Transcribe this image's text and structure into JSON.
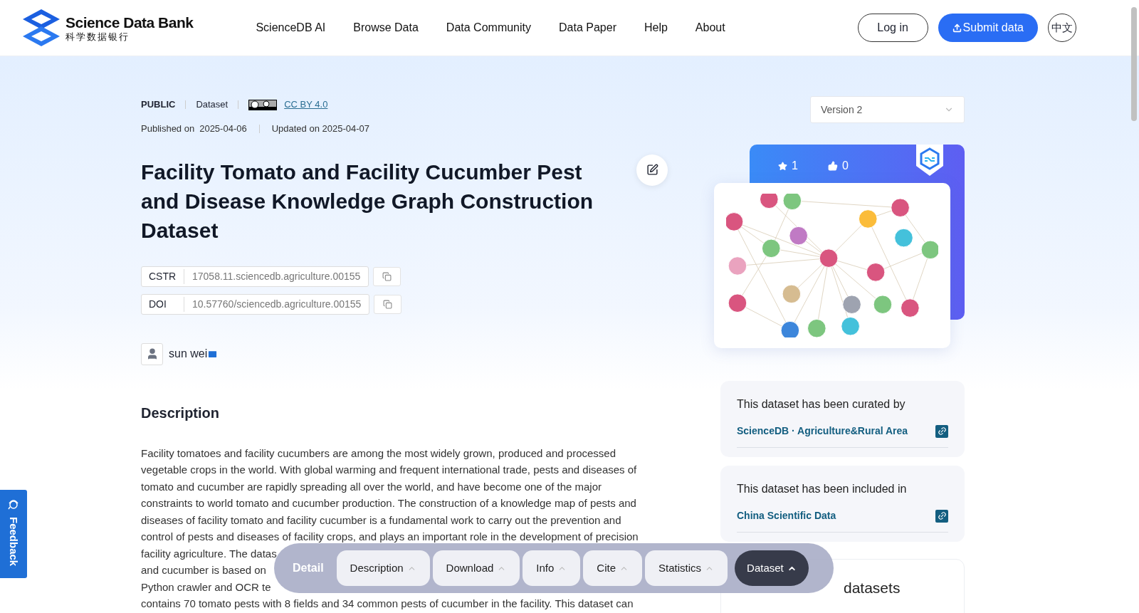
{
  "header": {
    "logo": {
      "title": "Science Data Bank",
      "subtitle": "科学数据银行"
    },
    "nav": [
      "ScienceDB AI",
      "Browse Data",
      "Data Community",
      "Data Paper",
      "Help",
      "About"
    ],
    "login": "Log in",
    "submit": "Submit data",
    "language": "中文"
  },
  "meta": {
    "access": "PUBLIC",
    "type": "Dataset",
    "license": "CC BY 4.0",
    "published_label": "Published on",
    "published": "2025-04-06",
    "updated": "Updated on 2025-04-07"
  },
  "title": "Facility Tomato and Facility Cucumber Pest and Disease Knowledge Graph Construction Dataset",
  "identifiers": [
    {
      "label": "CSTR",
      "value": "17058.11.sciencedb.agriculture.00155"
    },
    {
      "label": "DOI",
      "value": "10.57760/sciencedb.agriculture.00155"
    }
  ],
  "author": {
    "name": "sun wei"
  },
  "description": {
    "heading": "Description",
    "lines": [
      "Facility tomatoes and facility cucumbers are among the most widely grown, produced and processed",
      "vegetable crops in the world. With global warming and frequent international trade, pests and diseases of",
      "tomato and cucumber are rapidly spreading all over the world, and have become one of the major",
      "constraints to world tomato and cucumber production. The construction of a knowledge map of pests and",
      "diseases of facility tomato and facility cucumber is a fundamental work to carry out the prevention and",
      "control of pests and diseases of facility crops, and plays an important role in the development of precision",
      "facility agriculture. The datas",
      "and cucumber is based on",
      "Python crawler and OCR te",
      "contains 70 tomato pests with 8 fields and 34 common pests of cucumber in the facility. This dataset can"
    ]
  },
  "sidebar": {
    "version": "Version 2",
    "favorites": "1",
    "likes": "0",
    "cards": [
      {
        "caption": "This dataset has been curated by",
        "link": "ScienceDB · Agriculture&Rural Area"
      },
      {
        "caption": "This dataset has been included in",
        "link": "China Scientific Data"
      }
    ],
    "related": {
      "title": "datasets"
    }
  },
  "section_bar": {
    "title": "Detail",
    "items": [
      {
        "label": "Description",
        "selected": false
      },
      {
        "label": "Download",
        "selected": false
      },
      {
        "label": "Info",
        "selected": false
      },
      {
        "label": "Cite",
        "selected": false
      },
      {
        "label": "Statistics",
        "selected": false
      },
      {
        "label": "Dataset",
        "selected": true
      }
    ]
  },
  "feedback": "Feedback"
}
